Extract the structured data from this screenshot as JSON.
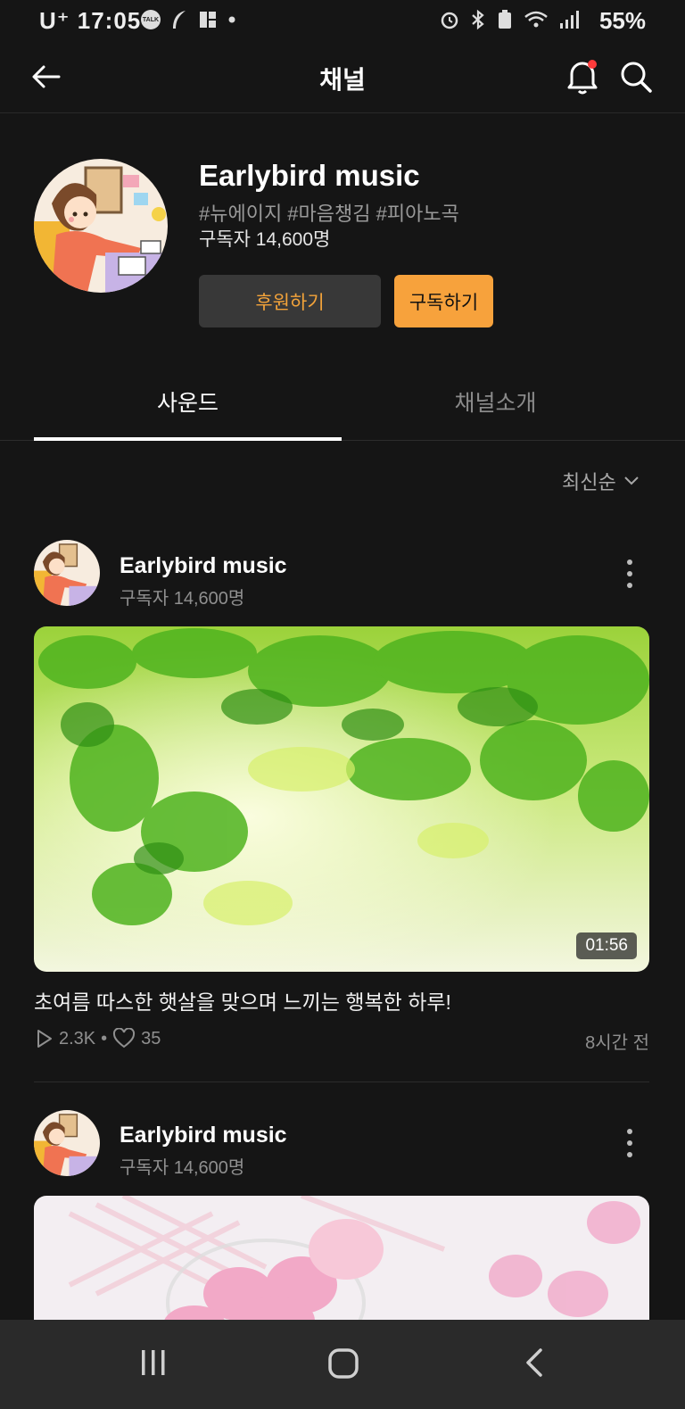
{
  "status_bar": {
    "carrier": "U⁺",
    "time": "17:05",
    "talk_badge": "TALK",
    "battery": "55%"
  },
  "header": {
    "title": "채널"
  },
  "channel": {
    "name": "Earlybird music",
    "tags": "#뉴에이지 #마음챙김 #피아노곡",
    "subscribers": "구독자 14,600명",
    "support_label": "후원하기",
    "subscribe_label": "구독하기"
  },
  "tabs": [
    {
      "label": "사운드",
      "active": true
    },
    {
      "label": "채널소개",
      "active": false
    }
  ],
  "sort": {
    "label": "최신순"
  },
  "posts": [
    {
      "author": "Earlybird music",
      "subscribers": "구독자 14,600명",
      "duration": "01:56",
      "title": "초여름 따스한 햇살을 맞으며 느끼는 행복한 하루!",
      "plays": "2.3K",
      "separator": "•",
      "likes": "35",
      "time_ago": "8시간 전"
    },
    {
      "author": "Earlybird music",
      "subscribers": "구독자 14,600명"
    }
  ],
  "colors": {
    "accent": "#f7a23c",
    "background": "#151515",
    "notification_dot": "#ff3b3b"
  }
}
